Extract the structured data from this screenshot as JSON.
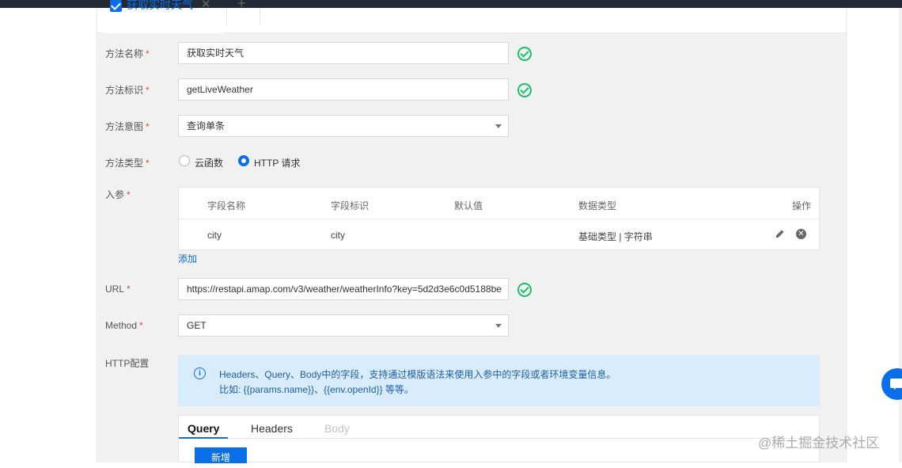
{
  "tab": {
    "label": "获取实时天气",
    "close": "✕",
    "add": "+"
  },
  "form": {
    "method_name": {
      "label": "方法名称",
      "required": "*",
      "value": "获取实时天气"
    },
    "method_id": {
      "label": "方法标识",
      "required": "*",
      "value": "getLiveWeather"
    },
    "method_intent": {
      "label": "方法意图",
      "required": "*",
      "value": "查询单条"
    },
    "method_type": {
      "label": "方法类型",
      "required": "*",
      "option_cloud": "云函数",
      "option_http": "HTTP 请求",
      "selected": "HTTP 请求"
    },
    "params": {
      "label": "入参",
      "required": "*",
      "headers": [
        "字段名称",
        "字段标识",
        "默认值",
        "数据类型",
        "操作"
      ],
      "rows": [
        {
          "name": "city",
          "id": "city",
          "default": "",
          "type": "基础类型 | 字符串"
        }
      ],
      "add_link": "添加"
    },
    "url": {
      "label": "URL",
      "required": "*",
      "value": "https://restapi.amap.com/v3/weather/weatherInfo?key=5d2d3e6c0d5188be"
    },
    "method": {
      "label": "Method",
      "required": "*",
      "value": "GET"
    },
    "http_config": {
      "label": "HTTP配置",
      "info_line1": "Headers、Query、Body中的字段，支持通过模版语法来使用入参中的字段或者环境变量信息。",
      "info_line2": "比如: {{params.name}}、{{env.openId}} 等等。",
      "tabs": [
        "Query",
        "Headers",
        "Body"
      ],
      "active_tab": "Query",
      "new_button": "新增"
    }
  },
  "watermark": "@稀土掘金技术社区",
  "colors": {
    "accent": "#0a6ee8",
    "success": "#1bbf6b",
    "required": "#e5493a",
    "info_bg": "#d9ecfb"
  }
}
